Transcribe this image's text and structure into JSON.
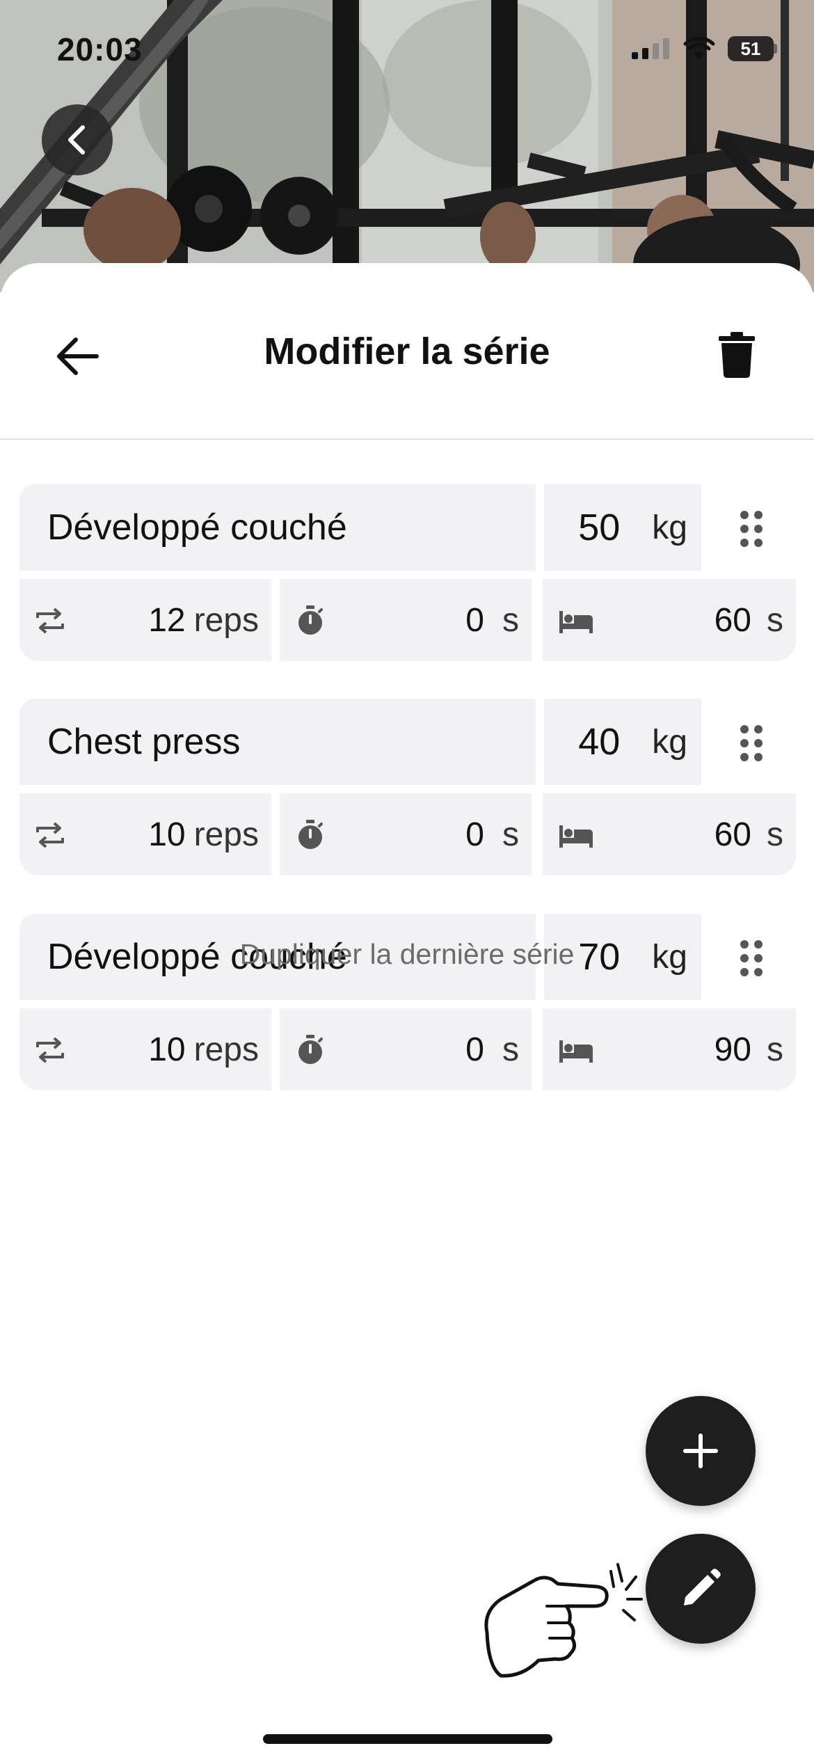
{
  "status_bar": {
    "time": "20:03",
    "battery": "51",
    "icons": [
      "signal-icon",
      "wifi-icon",
      "battery-icon"
    ]
  },
  "hero": {
    "image": "gym-photo",
    "back_icon": "chevron-left-icon"
  },
  "header": {
    "title": "Modifier la série",
    "back_icon": "arrow-left-icon",
    "delete_icon": "trash-icon"
  },
  "exercises": [
    {
      "name": "Développé couché",
      "weight": "50",
      "weight_unit": "kg",
      "reps": "12",
      "reps_unit": "reps",
      "time": "0",
      "time_unit": "s",
      "rest": "60",
      "rest_unit": "s"
    },
    {
      "name": "Chest press",
      "weight": "40",
      "weight_unit": "kg",
      "reps": "10",
      "reps_unit": "reps",
      "time": "0",
      "time_unit": "s",
      "rest": "60",
      "rest_unit": "s"
    },
    {
      "name": "Développé couché",
      "weight": "70",
      "weight_unit": "kg",
      "reps": "10",
      "reps_unit": "reps",
      "time": "0",
      "time_unit": "s",
      "rest": "90",
      "rest_unit": "s"
    }
  ],
  "cell_icons": {
    "reps": "repeat-icon",
    "time": "stopwatch-icon",
    "rest": "bed-icon",
    "drag": "drag-handle-icon"
  },
  "duplicate_label": "Dupliquer la dernière série",
  "fabs": {
    "add_icon": "plus-icon",
    "edit_icon": "pencil-icon"
  },
  "colors": {
    "cell_bg": "#f2f2f4",
    "fab_bg": "#1e1e1e",
    "muted_text": "#6b6b6b"
  }
}
